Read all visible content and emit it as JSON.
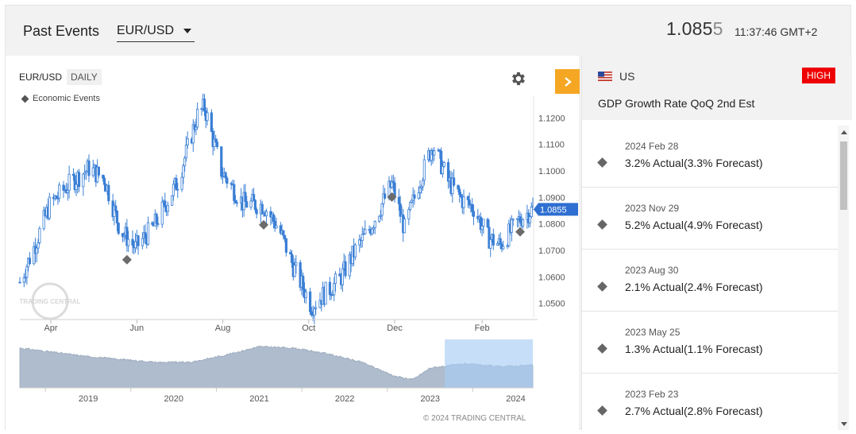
{
  "header": {
    "title": "Past Events",
    "symbol": "EUR/USD",
    "price_main": "1.085",
    "price_tail": "5",
    "time": "11:37:46 GMT+2"
  },
  "chart": {
    "symbol": "EUR/USD",
    "timeframe": "DAILY",
    "legend": "Economic Events",
    "copyright": "© 2024 TRADING CENTRAL",
    "watermark": "TRADING CENTRAL"
  },
  "chart_data": [
    {
      "type": "candlestick",
      "title": "",
      "x_ticks": [
        "Apr",
        "Jun",
        "Aug",
        "Oct",
        "Dec",
        "Feb"
      ],
      "y_ticks": [
        "1.1200",
        "1.1100",
        "1.1000",
        "1.0900",
        "1.0800",
        "1.0700",
        "1.0600",
        "1.0500"
      ],
      "ylim": [
        1.0445,
        1.127
      ],
      "current_price": "1.0855",
      "series": [
        {
          "name": "EUR/USD",
          "x": [
            "2023-03-10",
            "2023-03-20",
            "2023-03-31",
            "2023-04-14",
            "2023-04-28",
            "2023-05-09",
            "2023-05-20",
            "2023-05-31",
            "2023-06-13",
            "2023-06-30",
            "2023-07-14",
            "2023-07-19",
            "2023-07-31",
            "2023-08-15",
            "2023-08-30",
            "2023-09-10",
            "2023-09-20",
            "2023-10-03",
            "2023-10-13",
            "2023-10-23",
            "2023-11-03",
            "2023-11-13",
            "2023-11-29",
            "2023-12-08",
            "2023-12-18",
            "2023-12-28",
            "2024-01-08",
            "2024-01-18",
            "2024-01-26",
            "2024-02-05",
            "2024-02-14",
            "2024-02-28",
            "2024-03-08"
          ],
          "values": [
            1.058,
            1.071,
            1.087,
            1.095,
            1.101,
            1.097,
            1.078,
            1.071,
            1.079,
            1.096,
            1.121,
            1.124,
            1.1,
            1.088,
            1.087,
            1.078,
            1.064,
            1.049,
            1.054,
            1.059,
            1.07,
            1.078,
            1.095,
            1.078,
            1.095,
            1.11,
            1.096,
            1.089,
            1.086,
            1.075,
            1.072,
            1.082,
            1.0855
          ]
        }
      ],
      "events": [
        {
          "x": "2023-05-25",
          "label": "1.3% Actual(1.1% Forecast)"
        },
        {
          "x": "2023-08-30",
          "label": "2.1% Actual(2.4% Forecast)"
        },
        {
          "x": "2023-11-29",
          "label": "5.2% Actual(4.9% Forecast)"
        },
        {
          "x": "2024-02-28",
          "label": "3.2% Actual(3.3% Forecast)"
        }
      ]
    },
    {
      "type": "area",
      "title": "",
      "x_ticks": [
        "2019",
        "2020",
        "2021",
        "2022",
        "2023",
        "2024"
      ],
      "series": [
        {
          "name": "EUR/USD",
          "x": [
            2018.2,
            2018.6,
            2019.0,
            2019.4,
            2019.8,
            2020.2,
            2020.6,
            2021.0,
            2021.4,
            2021.8,
            2022.2,
            2022.6,
            2022.8,
            2023.0,
            2023.4,
            2023.8,
            2024.2
          ],
          "values": [
            1.2,
            1.17,
            1.14,
            1.12,
            1.1,
            1.1,
            1.15,
            1.21,
            1.2,
            1.16,
            1.1,
            1.0,
            0.98,
            1.06,
            1.09,
            1.07,
            1.08
          ]
        }
      ],
      "selected_range": [
        "2023-03",
        "2024-03"
      ]
    }
  ],
  "events_panel": {
    "country": "US",
    "importance": "HIGH",
    "event_title": "GDP Growth Rate QoQ 2nd Est",
    "items": [
      {
        "date": "2024 Feb 28",
        "value": "3.2% Actual(3.3% Forecast)"
      },
      {
        "date": "2023 Nov 29",
        "value": "5.2% Actual(4.9% Forecast)"
      },
      {
        "date": "2023 Aug 30",
        "value": "2.1% Actual(2.4% Forecast)"
      },
      {
        "date": "2023 May 25",
        "value": "1.3% Actual(1.1% Forecast)"
      },
      {
        "date": "2023 Feb 23",
        "value": "2.7% Actual(2.8% Forecast)"
      }
    ]
  },
  "colors": {
    "candle": "#3a7fd5",
    "accent": "#f5a623",
    "high_badge": "#ee0000",
    "navigator_fill": "#aebccd",
    "navigator_selection": "#a9ccf5"
  }
}
